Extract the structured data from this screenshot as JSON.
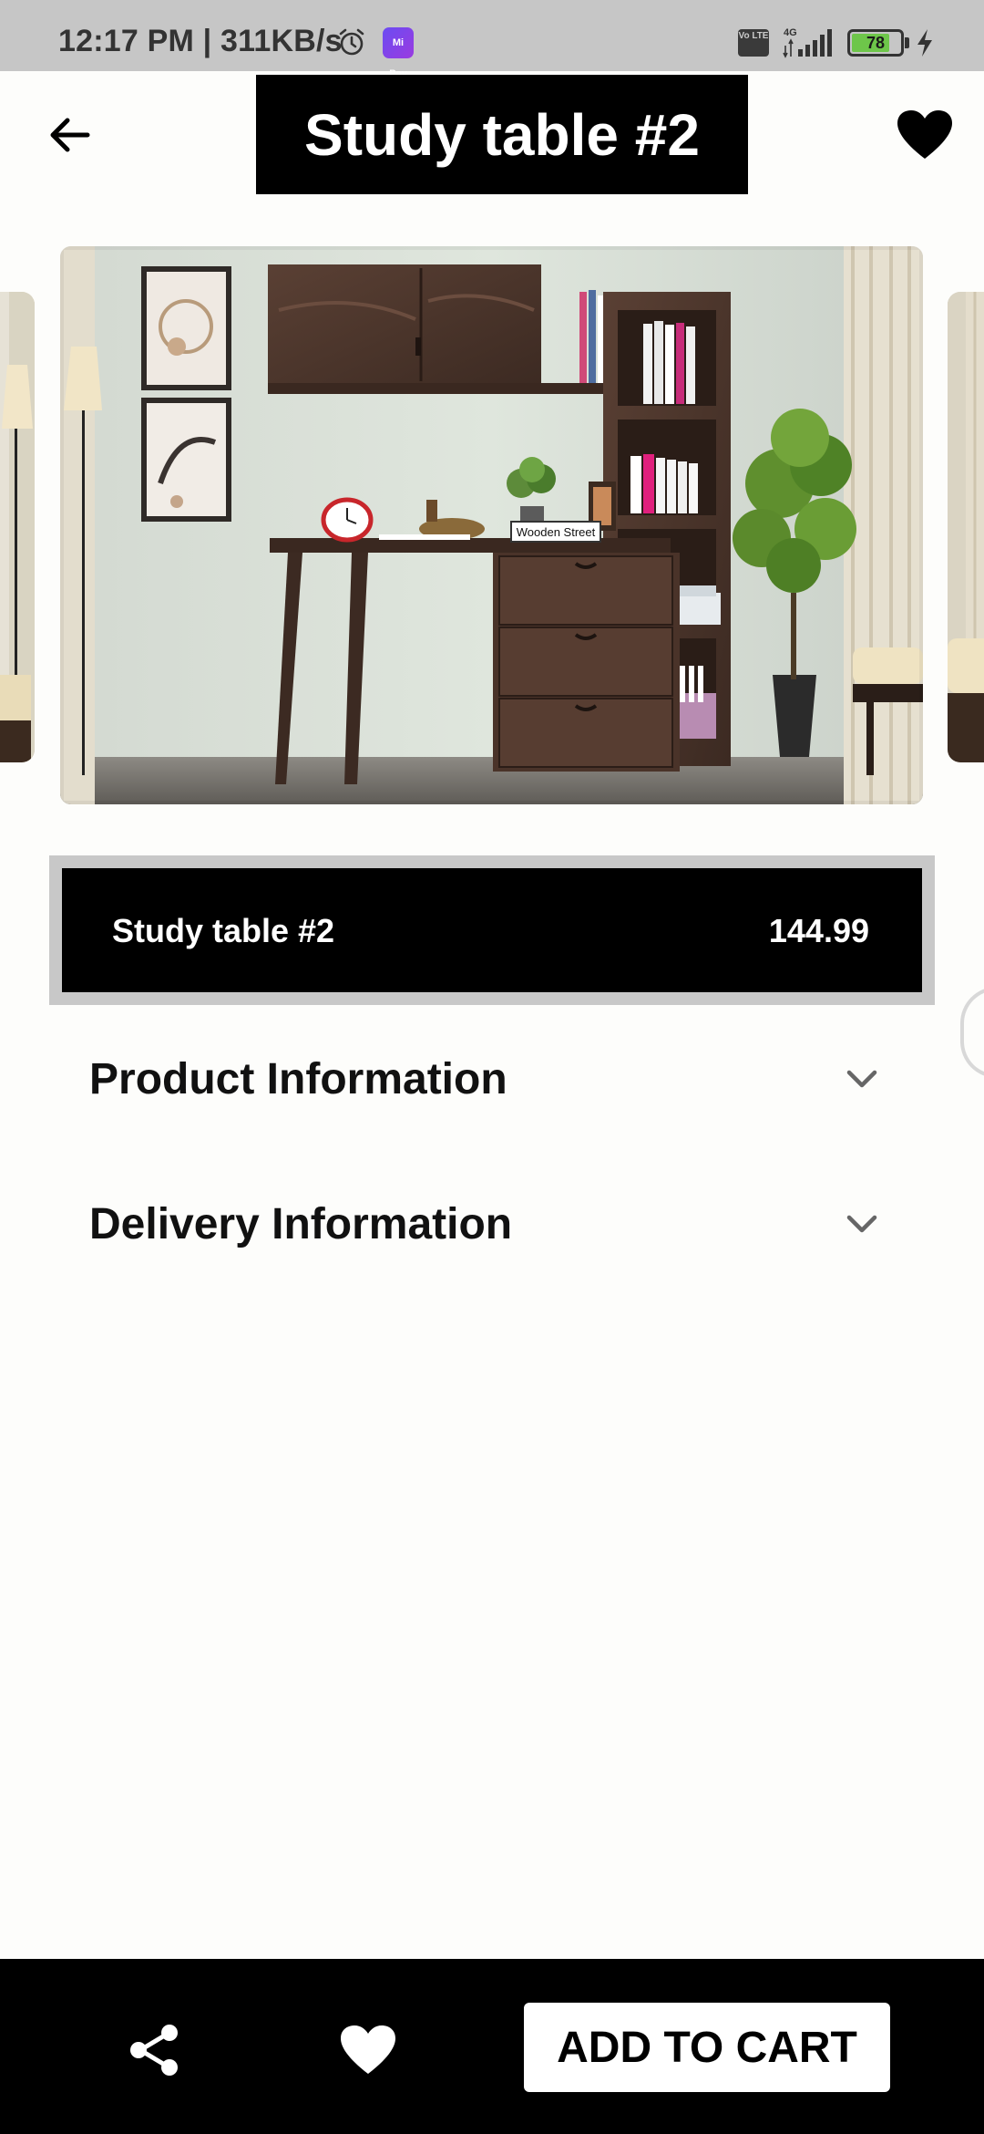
{
  "status_bar": {
    "time_text": "12:17 PM | 311KB/s",
    "mipay_label": "Mi Pay",
    "volte_label": "Vo LTE",
    "network_label": "4G",
    "battery_level": "78"
  },
  "header": {
    "back_icon": "arrow-left-icon",
    "title": "Study table #2",
    "favorite_icon": "heart-icon"
  },
  "carousel": {
    "image_alt": "Study table with cabinet, shelves and drawers",
    "product_tag_text": "Wooden Street"
  },
  "product": {
    "name": "Study table #2",
    "price": "144.99"
  },
  "sections": [
    {
      "title": "Product Information",
      "icon": "chevron-down-icon"
    },
    {
      "title": "Delivery Information",
      "icon": "chevron-down-icon"
    }
  ],
  "bottom_bar": {
    "share_icon": "share-icon",
    "favorite_icon": "heart-icon",
    "add_to_cart_label": "ADD TO CART"
  },
  "colors": {
    "status_bar_bg": "#c6c6c6",
    "page_bg": "#fdfdfb",
    "title_bg": "#000000",
    "title_text": "#ffffff",
    "price_bar_border": "#c8c8c8",
    "bottom_bar_bg": "#000000",
    "battery_fill": "#6ec64a"
  }
}
